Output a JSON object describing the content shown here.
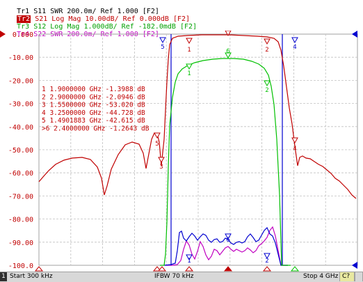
{
  "traces": [
    {
      "label": "Tr1",
      "param": "S11",
      "format": "SWR",
      "scale": "200.0m/",
      "ref": "Ref 1.000",
      "port": "[F2]",
      "color": "#000000",
      "active": false
    },
    {
      "label": "Tr2",
      "param": "S21",
      "format": "Log Mag",
      "scale": "10.00dB/",
      "ref": "Ref 0.000dB",
      "port": "[F2]",
      "color": "#c00000",
      "active": true
    },
    {
      "label": "Tr3",
      "param": "S12",
      "format": "Log Mag",
      "scale": "1.000dB/",
      "ref": "Ref -182.0mdB",
      "port": "[F2]",
      "color": "#00c000",
      "active": false
    },
    {
      "label": "Tr4",
      "param": "S22",
      "format": "SWR",
      "scale": "200.0m/",
      "ref": "Ref 1.000",
      "port": "[F2]",
      "color": "#c000c0",
      "active": false
    }
  ],
  "yaxis": {
    "ticks": [
      "0.000",
      "-10.00",
      "-20.00",
      "-30.00",
      "-40.00",
      "-50.00",
      "-60.00",
      "-70.00",
      "-80.00",
      "-90.00",
      "-100.0"
    ],
    "ref_color": "#c00000"
  },
  "markers": [
    {
      "num": "1",
      "freq": "1.9000000 GHz",
      "value": "-1.3988 dB",
      "active": false
    },
    {
      "num": "2",
      "freq": "2.9000000 GHz",
      "value": "-2.0946 dB",
      "active": false
    },
    {
      "num": "3",
      "freq": "1.5500000 GHz",
      "value": "-53.020 dB",
      "active": false
    },
    {
      "num": "4",
      "freq": "3.2500000 GHz",
      "value": "-44.728 dB",
      "active": false
    },
    {
      "num": "5",
      "freq": "1.4901883 GHz",
      "value": "-42.615 dB",
      "active": false
    },
    {
      "num": "6",
      "freq": "2.4000000 GHz",
      "value": "-1.2643 dB",
      "active": true
    }
  ],
  "status": {
    "channel": "1",
    "start": "Start 300 kHz",
    "ifbw": "IFBW 70 kHz",
    "stop": "Stop 4 GHz",
    "cal": "C?",
    "extra": ""
  },
  "colors": {
    "s11": "#0000d0",
    "s21": "#c00000",
    "s12": "#00c000",
    "s22": "#c000c0",
    "grid": "#c0c0c0",
    "background": "#ffffff"
  }
}
